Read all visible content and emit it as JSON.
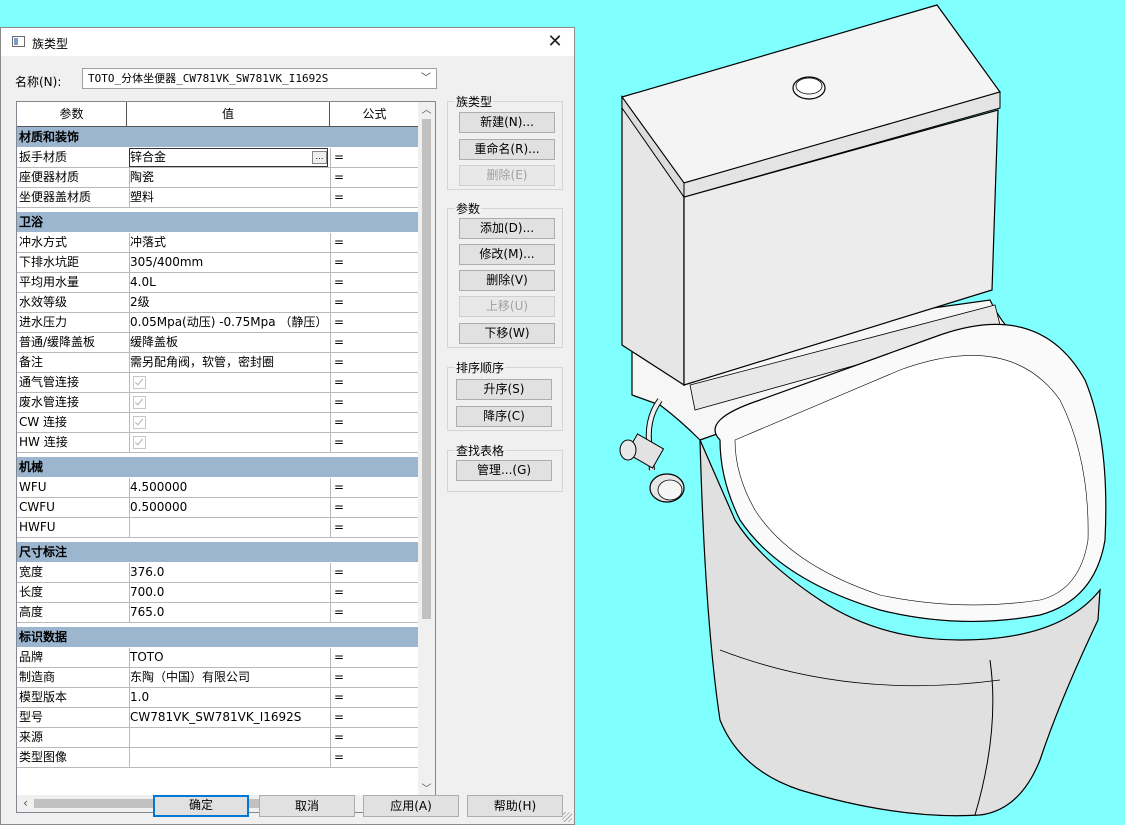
{
  "dialog": {
    "title": "族类型",
    "name_label": "名称(N):",
    "name_value": "TOTO_分体坐便器_CW781VK_SW781VK_I1692S"
  },
  "grid": {
    "headers": [
      "参数",
      "值",
      "公式"
    ],
    "groups": [
      {
        "name": "材质和装饰",
        "rows": [
          {
            "param": "扳手材质",
            "value": "锌合金",
            "formula": "="
          },
          {
            "param": "座便器材质",
            "value": "陶瓷",
            "formula": "="
          },
          {
            "param": "坐便器盖材质",
            "value": "塑料",
            "formula": "="
          }
        ]
      },
      {
        "name": "卫浴",
        "rows": [
          {
            "param": "冲水方式",
            "value": "冲落式",
            "formula": "="
          },
          {
            "param": "下排水坑距",
            "value": "305/400mm",
            "formula": "="
          },
          {
            "param": "平均用水量",
            "value": "4.0L",
            "formula": "="
          },
          {
            "param": "水效等级",
            "value": "2级",
            "formula": "="
          },
          {
            "param": "进水压力",
            "value": "0.05Mpa(动压) -0.75Mpa （静压）",
            "formula": "="
          },
          {
            "param": "普通/缓降盖板",
            "value": "缓降盖板",
            "formula": "="
          },
          {
            "param": "备注",
            "value": "需另配角阀，软管，密封圈",
            "formula": "="
          },
          {
            "param": "通气管连接",
            "value": "",
            "formula": "="
          },
          {
            "param": "废水管连接",
            "value": "",
            "formula": "="
          },
          {
            "param": "CW 连接",
            "value": "",
            "formula": "="
          },
          {
            "param": "HW 连接",
            "value": "",
            "formula": "="
          }
        ]
      },
      {
        "name": "机械",
        "rows": [
          {
            "param": "WFU",
            "value": "4.500000",
            "formula": "="
          },
          {
            "param": "CWFU",
            "value": "0.500000",
            "formula": "="
          },
          {
            "param": "HWFU",
            "value": "",
            "formula": "="
          }
        ]
      },
      {
        "name": "尺寸标注",
        "rows": [
          {
            "param": "宽度",
            "value": "376.0",
            "formula": "="
          },
          {
            "param": "长度",
            "value": "700.0",
            "formula": "="
          },
          {
            "param": "高度",
            "value": "765.0",
            "formula": "="
          }
        ]
      },
      {
        "name": "标识数据",
        "rows": [
          {
            "param": "品牌",
            "value": "TOTO",
            "formula": "="
          },
          {
            "param": "制造商",
            "value": "东陶（中国）有限公司",
            "formula": "="
          },
          {
            "param": "模型版本",
            "value": "1.0",
            "formula": "="
          },
          {
            "param": "型号",
            "value": "CW781VK_SW781VK_I1692S",
            "formula": "="
          },
          {
            "param": "来源",
            "value": "",
            "formula": "="
          },
          {
            "param": "类型图像",
            "value": "",
            "formula": "="
          }
        ]
      }
    ]
  },
  "panels": {
    "family_types": {
      "title": "族类型",
      "new": "新建(N)...",
      "rename": "重命名(R)...",
      "delete": "删除(E)"
    },
    "parameters": {
      "title": "参数",
      "add": "添加(D)...",
      "modify": "修改(M)...",
      "delete": "删除(V)",
      "move_up": "上移(U)",
      "move_down": "下移(W)"
    },
    "sort": {
      "title": "排序顺序",
      "asc": "升序(S)",
      "desc": "降序(C)"
    },
    "lookup": {
      "title": "查找表格",
      "manage": "管理...(G)"
    }
  },
  "footer": {
    "ok": "确定",
    "cancel": "取消",
    "apply": "应用(A)",
    "help": "帮助(H)"
  },
  "icons": {
    "close": "close-icon",
    "ellipsis": "ellipsis-icon",
    "dropdown": "chevron-down-icon",
    "checkbox": "checkbox-checked-icon"
  },
  "colors": {
    "viewport_background": "#80ffff",
    "group_header": "#9db6d0",
    "primary_button_border": "#0078d7"
  }
}
